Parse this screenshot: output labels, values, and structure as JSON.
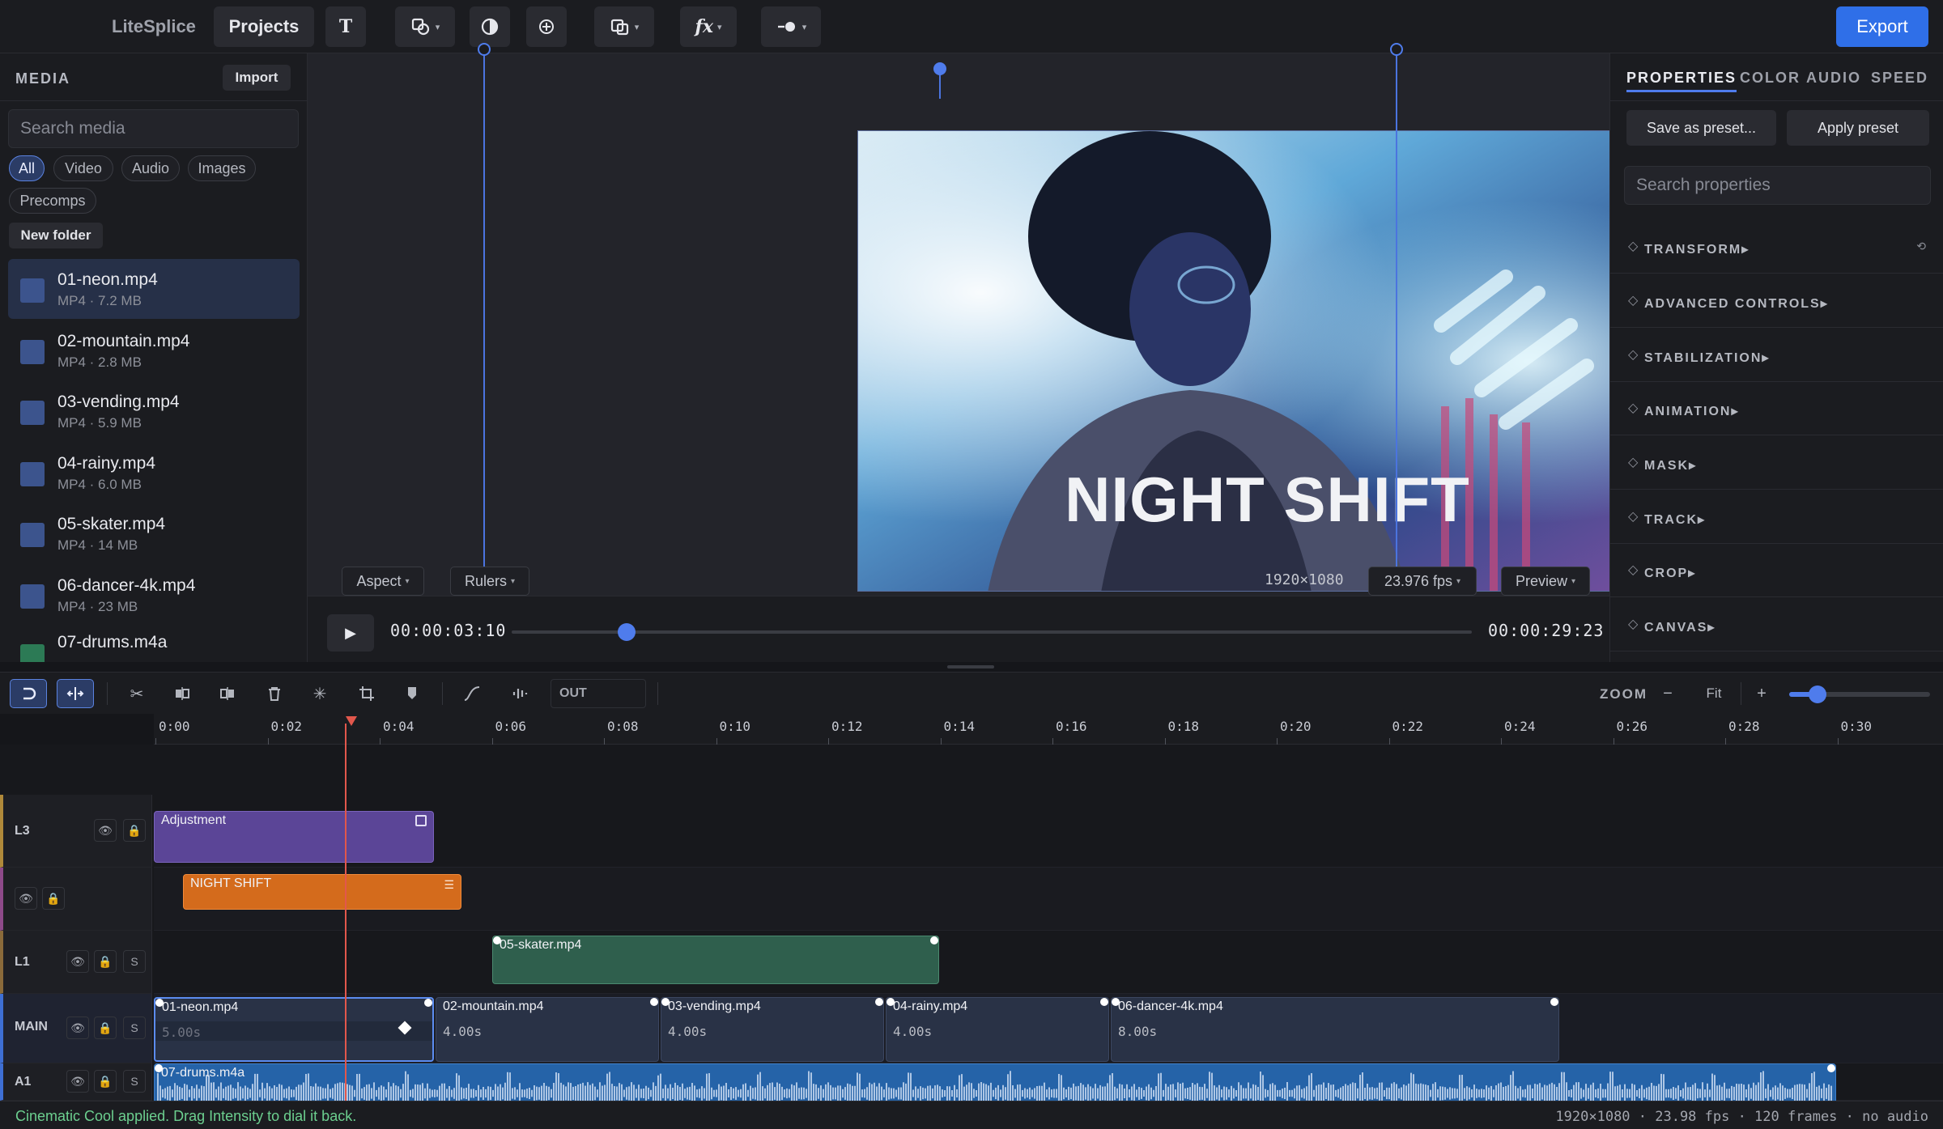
{
  "app": {
    "name": "LiteSplice"
  },
  "toolbar": {
    "projects_label": "Projects",
    "text_tool": "T",
    "fx_tool": "fx",
    "export_label": "Export",
    "icons": [
      "shapes-icon",
      "contrast-icon",
      "add-target-icon",
      "overlay-icon",
      "fx-icon",
      "toggle-icon"
    ]
  },
  "media": {
    "title": "MEDIA",
    "import_label": "Import",
    "search_placeholder": "Search media",
    "filters": [
      "All",
      "Video",
      "Audio",
      "Images",
      "Precomps"
    ],
    "active_filter": "All",
    "new_folder_label": "New folder",
    "items": [
      {
        "name": "01-neon.mp4",
        "meta": "MP4 · 7.2 MB"
      },
      {
        "name": "02-mountain.mp4",
        "meta": "MP4 · 2.8 MB"
      },
      {
        "name": "03-vending.mp4",
        "meta": "MP4 · 5.9 MB"
      },
      {
        "name": "04-rainy.mp4",
        "meta": "MP4 · 6.0 MB"
      },
      {
        "name": "05-skater.mp4",
        "meta": "MP4 · 14 MB"
      },
      {
        "name": "06-dancer-4k.mp4",
        "meta": "MP4 · 23 MB"
      },
      {
        "name": "07-drums.m4a",
        "meta": ""
      }
    ]
  },
  "viewer": {
    "overlay_title": "NIGHT SHIFT",
    "aspect_label": "Aspect",
    "rulers_label": "Rulers",
    "resolution": "1920×1080",
    "fps_label": "23.976 fps",
    "preview_label": "Preview",
    "current_tc": "00:00:03:10",
    "duration_tc": "00:00:29:23",
    "playhead_fraction": 0.12
  },
  "properties": {
    "tabs": [
      "PROPERTIES",
      "COLOR",
      "AUDIO",
      "SPEED"
    ],
    "active_tab": "PROPERTIES",
    "save_preset_label": "Save as preset...",
    "apply_preset_label": "Apply preset",
    "search_placeholder": "Search properties",
    "sections": [
      "TRANSFORM",
      "ADVANCED CONTROLS",
      "STABILIZATION",
      "ANIMATION",
      "MASK",
      "TRACK",
      "CROP",
      "CANVAS"
    ]
  },
  "timeline": {
    "out_label": "OUT",
    "zoom_label": "ZOOM",
    "zoom_minus": "−",
    "zoom_fit": "Fit",
    "zoom_plus": "+",
    "zoom_level": 0.2,
    "ruler": [
      "0:00",
      "0:02",
      "0:04",
      "0:06",
      "0:08",
      "0:10",
      "0:12",
      "0:14",
      "0:16",
      "0:18",
      "0:20",
      "0:22",
      "0:24",
      "0:26",
      "0:28",
      "0:30"
    ],
    "tracks": {
      "l3": "L3",
      "l1": "L1",
      "main": "MAIN",
      "a1": "A1",
      "solo": "S"
    },
    "clips": {
      "adjustment": "Adjustment",
      "title": "NIGHT SHIFT",
      "skater": "05-skater.mp4",
      "main": [
        {
          "name": "01-neon.mp4",
          "dur": "5.00s"
        },
        {
          "name": "02-mountain.mp4",
          "dur": "4.00s"
        },
        {
          "name": "03-vending.mp4",
          "dur": "4.00s"
        },
        {
          "name": "04-rainy.mp4",
          "dur": "4.00s"
        },
        {
          "name": "06-dancer-4k.mp4",
          "dur": "8.00s"
        }
      ],
      "audio": "07-drums.m4a"
    }
  },
  "status": {
    "message": "Cinematic Cool applied. Drag Intensity to dial it back.",
    "info": "1920×1080 · 23.98 fps · 120 frames · no audio"
  },
  "colors": {
    "accent": "#2f6fe8",
    "adjustment_clip": "#5b4597",
    "title_clip": "#d46b1c",
    "video_clip": "#2f5f4d",
    "main_clip": "#293246",
    "audio_clip": "#2563a8",
    "playhead": "#e2574c",
    "status_ok": "#6ccf8f"
  }
}
